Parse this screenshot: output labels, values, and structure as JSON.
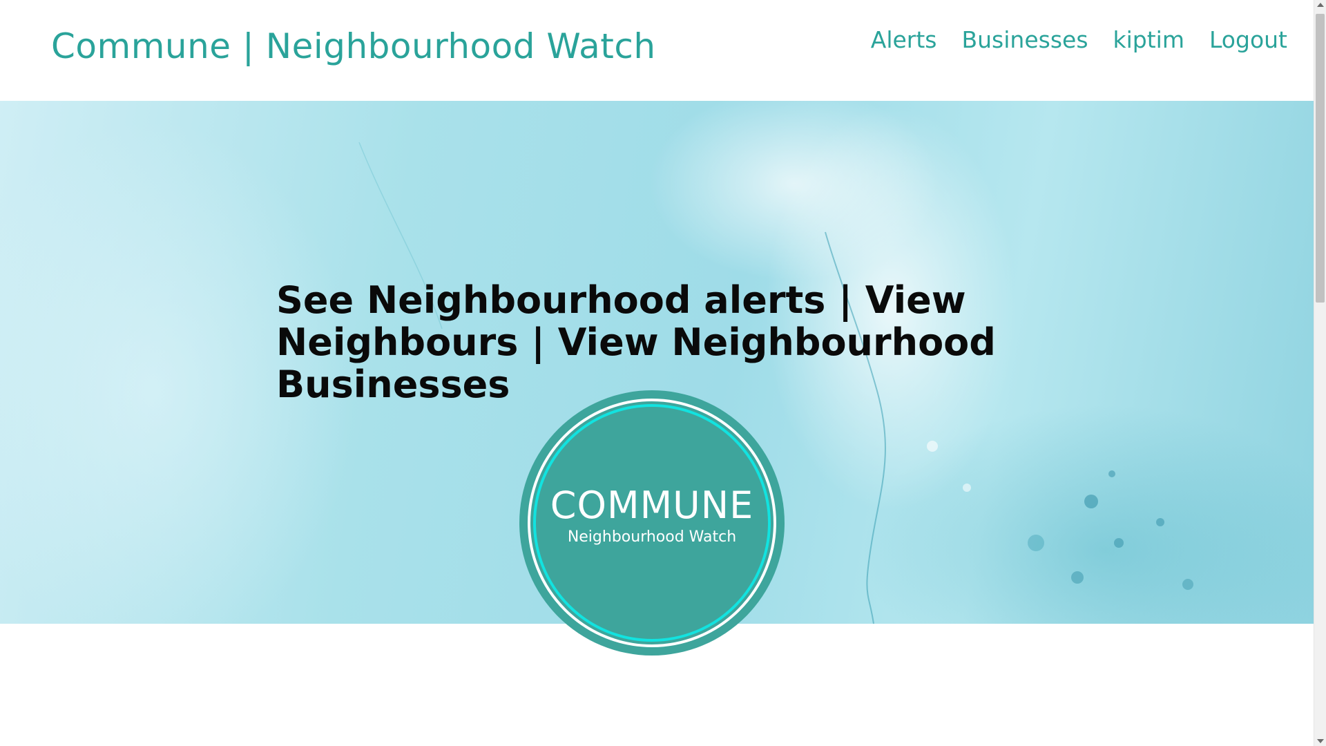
{
  "navbar": {
    "brand": "Commune | Neighbourhood Watch",
    "links": [
      {
        "label": "Alerts"
      },
      {
        "label": "Businesses"
      },
      {
        "label": "kiptim"
      },
      {
        "label": "Logout"
      }
    ]
  },
  "hero": {
    "headline": "See Neighbourhood alerts | View Neighbours | View Neighbourhood Businesses"
  },
  "logo": {
    "title": "COMMUNE",
    "subtitle": "Neighbourhood Watch"
  },
  "colors": {
    "brand_teal": "#2aa39a",
    "logo_fill": "#3ea59c",
    "logo_ring": "#12e3e0",
    "headline": "#0a0a0a"
  }
}
